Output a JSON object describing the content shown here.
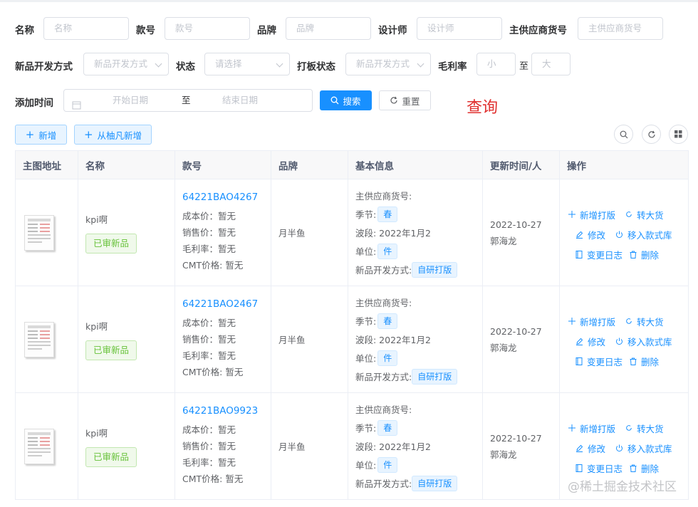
{
  "filters": {
    "name": {
      "label": "名称",
      "placeholder": "名称"
    },
    "code": {
      "label": "款号",
      "placeholder": "款号"
    },
    "brand": {
      "label": "品牌",
      "placeholder": "品牌"
    },
    "designer": {
      "label": "设计师",
      "placeholder": "设计师"
    },
    "supplier_code": {
      "label": "主供应商货号",
      "placeholder": "主供应商货号"
    },
    "dev_method": {
      "label": "新品开发方式",
      "placeholder": "新品开发方式"
    },
    "status": {
      "label": "状态",
      "placeholder": "请选择"
    },
    "sample_status": {
      "label": "打板状态",
      "placeholder": "新品开发方式"
    },
    "margin": {
      "label": "毛利率",
      "min_placeholder": "小",
      "separator": "至",
      "max_placeholder": "大"
    },
    "add_time": {
      "label": "添加时间",
      "start_placeholder": "开始日期",
      "separator": "至",
      "end_placeholder": "结束日期"
    }
  },
  "actions": {
    "search": "搜索",
    "reset": "重置",
    "add": "新增",
    "add_from": "从柚凡新增"
  },
  "annotation": "查询",
  "table": {
    "headers": [
      "主图地址",
      "名称",
      "款号",
      "品牌",
      "基本信息",
      "更新时间/人",
      "操作"
    ],
    "rows": [
      {
        "name": "kpi啊",
        "status_tag": "已审新品",
        "code": "64221BAO4267",
        "cost": "成本价：暂无",
        "sale": "销售价：暂无",
        "margin": "毛利率：暂无",
        "cmt": "CMT价格: 暂无",
        "brand": "月半鱼",
        "supplier": "主供应商货号:",
        "season_label": "季节:",
        "season": "春",
        "wave": "波段: 2022年1月2",
        "unit_label": "单位:",
        "unit": "件",
        "dev_label": "新品开发方式:",
        "dev": "自研打版",
        "date": "2022-10-27",
        "user": "郭海龙"
      },
      {
        "name": "kpi啊",
        "status_tag": "已审新品",
        "code": "64221BAO2467",
        "cost": "成本价：暂无",
        "sale": "销售价：暂无",
        "margin": "毛利率：暂无",
        "cmt": "CMT价格: 暂无",
        "brand": "月半鱼",
        "supplier": "主供应商货号:",
        "season_label": "季节:",
        "season": "春",
        "wave": "波段: 2022年1月2",
        "unit_label": "单位:",
        "unit": "件",
        "dev_label": "新品开发方式:",
        "dev": "自研打版",
        "date": "2022-10-27",
        "user": "郭海龙"
      },
      {
        "name": "kpi啊",
        "status_tag": "已审新品",
        "code": "64221BAO9923",
        "cost": "成本价：暂无",
        "sale": "销售价：暂无",
        "margin": "毛利率：暂无",
        "cmt": "CMT价格: 暂无",
        "brand": "月半鱼",
        "supplier": "主供应商货号:",
        "season_label": "季节:",
        "season": "春",
        "wave": "波段: 2022年1月2",
        "unit_label": "单位:",
        "unit": "件",
        "dev_label": "新品开发方式:",
        "dev": "自研打版",
        "date": "2022-10-27",
        "user": "郭海龙"
      }
    ]
  },
  "row_ops": {
    "new_sample": "新增打版",
    "to_bulk": "转大货",
    "edit": "修改",
    "move_library": "移入款式库",
    "change_log": "变更日志",
    "delete": "删除"
  },
  "watermark": "@稀土掘金技术社区",
  "colors": {
    "primary": "#1890ff",
    "success": "#67c23a",
    "annotation": "#e0302f"
  }
}
